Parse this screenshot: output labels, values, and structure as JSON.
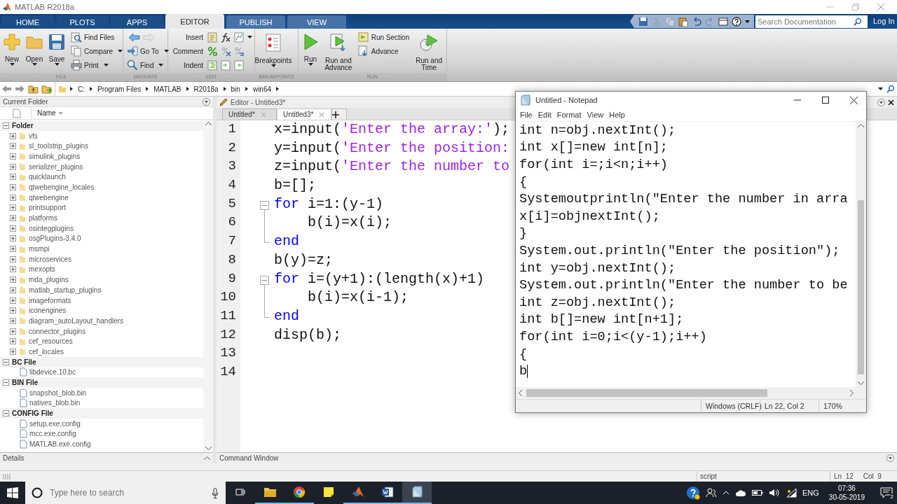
{
  "window": {
    "title": "MATLAB R2018a"
  },
  "toolstrip_tabs": [
    {
      "label": "HOME",
      "selected": false,
      "contextual": false
    },
    {
      "label": "PLOTS",
      "selected": false,
      "contextual": false
    },
    {
      "label": "APPS",
      "selected": false,
      "contextual": false
    },
    {
      "label": "EDITOR",
      "selected": true,
      "contextual": true
    },
    {
      "label": "PUBLISH",
      "selected": false,
      "contextual": true
    },
    {
      "label": "VIEW",
      "selected": false,
      "contextual": true
    }
  ],
  "search": {
    "placeholder": "Search Documentation"
  },
  "login": "Log In",
  "ribbon": [
    {
      "label": "FILE",
      "columns": [
        [
          {
            "kind": "large",
            "label": "New",
            "menu": true
          }
        ],
        [
          {
            "kind": "large",
            "label": "Open",
            "menu": true
          }
        ],
        [
          {
            "kind": "large",
            "label": "Save",
            "menu": true
          }
        ],
        [
          {
            "kind": "small",
            "label": "Find Files",
            "menu": false
          },
          {
            "kind": "small",
            "label": "Compare",
            "menu": true
          },
          {
            "kind": "small",
            "label": "Print",
            "menu": true
          }
        ]
      ]
    },
    {
      "label": "NAVIGATE",
      "columns": [
        [
          {
            "kind": "arrows",
            "forward_disabled": true
          },
          {
            "kind": "small",
            "label": "Go To",
            "menu": true
          },
          {
            "kind": "small",
            "label": "Find",
            "menu": true
          }
        ]
      ]
    },
    {
      "label": "EDIT",
      "columns": [
        [
          {
            "kind": "tools",
            "label": "Insert",
            "menu": true
          },
          {
            "kind": "tools",
            "label": "Comment",
            "menu": false
          },
          {
            "kind": "tools",
            "label": "Indent",
            "menu": false
          }
        ]
      ]
    },
    {
      "label": "BREAKPOINTS",
      "columns": [
        [
          {
            "kind": "large",
            "label": "Breakpoints",
            "menu": true
          }
        ]
      ]
    },
    {
      "label": "RUN",
      "columns": [
        [
          {
            "kind": "large",
            "label": "Run",
            "menu": true
          }
        ],
        [
          {
            "kind": "large",
            "label": "Run and Advance",
            "menu": false
          }
        ],
        [
          {
            "kind": "small",
            "label": "Run Section",
            "menu": false
          },
          {
            "kind": "small",
            "label": "Advance",
            "menu": false
          }
        ],
        [
          {
            "kind": "large",
            "label": "Run and Time",
            "menu": false
          }
        ]
      ]
    }
  ],
  "address_bar": {
    "path": [
      "C:",
      "Program Files",
      "MATLAB",
      "R2018a",
      "bin",
      "win64"
    ]
  },
  "current_folder": {
    "title": "Current Folder",
    "column": "Name",
    "groups": [
      {
        "label": "Folder",
        "expanded": true,
        "items": [
          {
            "name": "vfs",
            "kind": "folder"
          },
          {
            "name": "sl_toolstrip_plugins",
            "kind": "folder"
          },
          {
            "name": "simulink_plugins",
            "kind": "folder"
          },
          {
            "name": "serializer_plugins",
            "kind": "folder"
          },
          {
            "name": "quicklaunch",
            "kind": "folder"
          },
          {
            "name": "qtwebengine_locales",
            "kind": "folder"
          },
          {
            "name": "qtwebengine",
            "kind": "folder"
          },
          {
            "name": "printsupport",
            "kind": "folder"
          },
          {
            "name": "platforms",
            "kind": "folder"
          },
          {
            "name": "osintegplugins",
            "kind": "folder"
          },
          {
            "name": "osgPlugins-3.4.0",
            "kind": "folder"
          },
          {
            "name": "msmpi",
            "kind": "folder"
          },
          {
            "name": "microservices",
            "kind": "folder"
          },
          {
            "name": "mexopts",
            "kind": "folder"
          },
          {
            "name": "mda_plugins",
            "kind": "folder"
          },
          {
            "name": "matlab_startup_plugins",
            "kind": "folder"
          },
          {
            "name": "imageformats",
            "kind": "folder"
          },
          {
            "name": "iconengines",
            "kind": "folder"
          },
          {
            "name": "diagram_autoLayout_handlers",
            "kind": "folder"
          },
          {
            "name": "connector_plugins",
            "kind": "folder"
          },
          {
            "name": "cef_resources",
            "kind": "folder"
          },
          {
            "name": "cef_locales",
            "kind": "folder"
          }
        ]
      },
      {
        "label": "BC File",
        "expanded": true,
        "items": [
          {
            "name": "libdevice.10.bc",
            "kind": "file"
          }
        ]
      },
      {
        "label": "BIN File",
        "expanded": true,
        "items": [
          {
            "name": "snapshot_blob.bin",
            "kind": "file"
          },
          {
            "name": "natives_blob.bin",
            "kind": "file"
          }
        ]
      },
      {
        "label": "CONFIG File",
        "expanded": true,
        "items": [
          {
            "name": "setup.exe.config",
            "kind": "file"
          },
          {
            "name": "mcc.exe.config",
            "kind": "file"
          },
          {
            "name": "MATLAB.exe.config",
            "kind": "file"
          }
        ]
      }
    ]
  },
  "details": {
    "title": "Details"
  },
  "editor": {
    "title": "Editor - Untitled3*",
    "tabs": [
      {
        "label": "Untitled*",
        "selected": false
      },
      {
        "label": "Untitled3*",
        "selected": true
      }
    ],
    "lines": [
      {
        "number": "1",
        "kind": "plain",
        "segments": [
          {
            "kind": "plain",
            "text": "x=input("
          },
          {
            "kind": "string",
            "text": "'Enter the array:'"
          },
          {
            "kind": "plain",
            "text": ");"
          }
        ]
      },
      {
        "number": "2",
        "kind": "plain",
        "segments": [
          {
            "kind": "plain",
            "text": "y=input("
          },
          {
            "kind": "string",
            "text": "'Enter the position:"
          }
        ]
      },
      {
        "number": "3",
        "kind": "plain",
        "segments": [
          {
            "kind": "plain",
            "text": "z=input("
          },
          {
            "kind": "string",
            "text": "'Enter the number to"
          }
        ]
      },
      {
        "number": "4",
        "kind": "plain",
        "segments": [
          {
            "kind": "plain",
            "text": "b=[];"
          }
        ]
      },
      {
        "number": "5",
        "kind": "open",
        "segments": [
          {
            "kind": "keyword",
            "text": "for"
          },
          {
            "kind": "plain",
            "text": " i=1:(y-1)"
          }
        ]
      },
      {
        "number": "6",
        "kind": "inner",
        "segments": [
          {
            "kind": "plain",
            "text": "    b(i)=x(i);"
          }
        ]
      },
      {
        "number": "7",
        "kind": "close",
        "segments": [
          {
            "kind": "keyword",
            "text": "end"
          }
        ]
      },
      {
        "number": "8",
        "kind": "plain",
        "segments": [
          {
            "kind": "plain",
            "text": "b(y)=z;"
          }
        ]
      },
      {
        "number": "9",
        "kind": "open",
        "segments": [
          {
            "kind": "keyword",
            "text": "for"
          },
          {
            "kind": "plain",
            "text": " i=(y+1):(length(x)+1)"
          }
        ]
      },
      {
        "number": "10",
        "kind": "inner",
        "segments": [
          {
            "kind": "plain",
            "text": "    b(i)=x(i-1);"
          }
        ]
      },
      {
        "number": "11",
        "kind": "close",
        "segments": [
          {
            "kind": "keyword",
            "text": "end"
          }
        ]
      },
      {
        "number": "12",
        "kind": "plain",
        "segments": [
          {
            "kind": "plain",
            "text": "disp(b);"
          }
        ]
      },
      {
        "number": "13",
        "kind": "plain"
      },
      {
        "number": "14",
        "kind": "plain"
      }
    ]
  },
  "command_window": {
    "title": "Command Window"
  },
  "status_bar": {
    "mode": "script",
    "line": "Ln  12",
    "column": "Col  9"
  },
  "notepad": {
    "title": "Untitled - Notepad",
    "menu": [
      "File",
      "Edit",
      "Format",
      "View",
      "Help"
    ],
    "lines": [
      "int n=obj.nextInt();",
      "int x[]=new int[n];",
      "for(int i=;i<n;i++)",
      "{",
      "Systemoutprintln(\"Enter the number in arra",
      "x[i]=objnextInt();",
      "}",
      "System.out.println(\"Enter the position\");",
      "int y=obj.nextInt();",
      "System.out.println(\"Enter the number to be",
      "int z=obj.nextInt();",
      "int b[]=new int[n+1];",
      "for(int i=0;i<(y-1);i++)",
      "{",
      "b"
    ],
    "status": [
      "Windows (CRLF)",
      "Ln 22, Col 2",
      "170%"
    ]
  },
  "taskbar": {
    "search_placeholder": "Type here to search",
    "apps": [
      {
        "running": true,
        "selected": false
      },
      {
        "running": true,
        "selected": false
      },
      {
        "running": false,
        "selected": false
      },
      {
        "running": true,
        "selected": false
      },
      {
        "running": true,
        "selected": false
      },
      {
        "running": true,
        "selected": true
      }
    ],
    "language": "ENG",
    "time": "07:36",
    "date": "30-05-2019",
    "notifications": "2"
  }
}
